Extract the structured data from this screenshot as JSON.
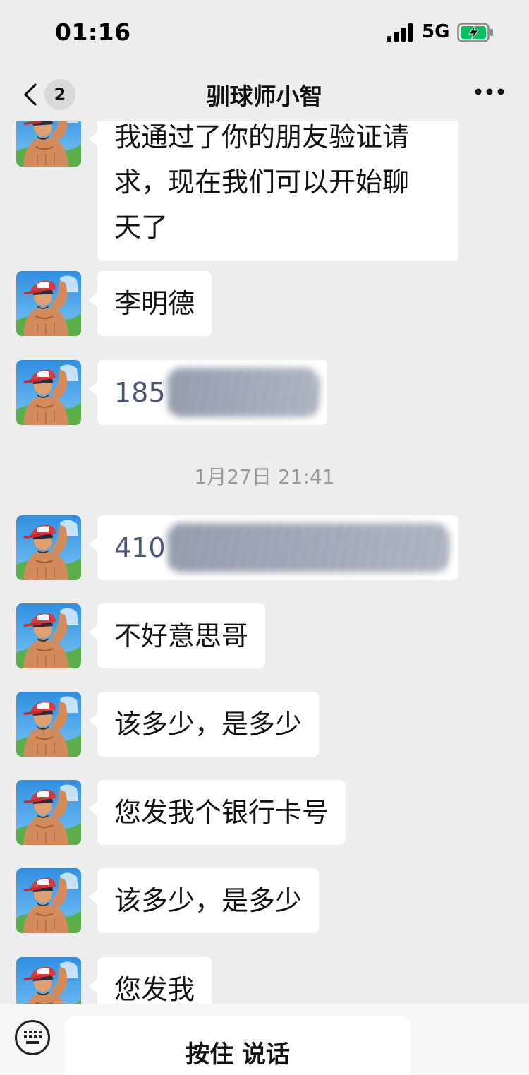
{
  "status_bar": {
    "time": "01:16",
    "network": "5G",
    "icons": [
      "signal-icon",
      "battery-charging-icon"
    ]
  },
  "nav": {
    "back_icon": "chevron-left-icon",
    "unread_count": "2",
    "title": "驯球师小智",
    "more_icon": "more-icon"
  },
  "messages": [
    {
      "type": "text",
      "lines": [
        "我通过了你的朋友验证请",
        "求，现在我们可以开始聊",
        "天了"
      ]
    },
    {
      "type": "text",
      "text": "李明德"
    },
    {
      "type": "redacted",
      "visible_prefix": "185"
    },
    {
      "type": "timestamp",
      "text": "1月27日 21:41"
    },
    {
      "type": "redacted",
      "visible_prefix": "410"
    },
    {
      "type": "text",
      "text": "不好意思哥"
    },
    {
      "type": "text",
      "text": "该多少，是多少"
    },
    {
      "type": "text",
      "text": "您发我个银行卡号"
    },
    {
      "type": "text",
      "text": "该多少，是多少"
    },
    {
      "type": "text",
      "text": "您发我"
    }
  ],
  "input_bar": {
    "keyboard_icon": "keyboard-icon",
    "hold_to_talk_label": "按住 说话"
  },
  "colors": {
    "background": "#ededed",
    "bubble": "#ffffff",
    "battery_charge": "#07c160",
    "timestamp_text": "#9a9a9a"
  }
}
